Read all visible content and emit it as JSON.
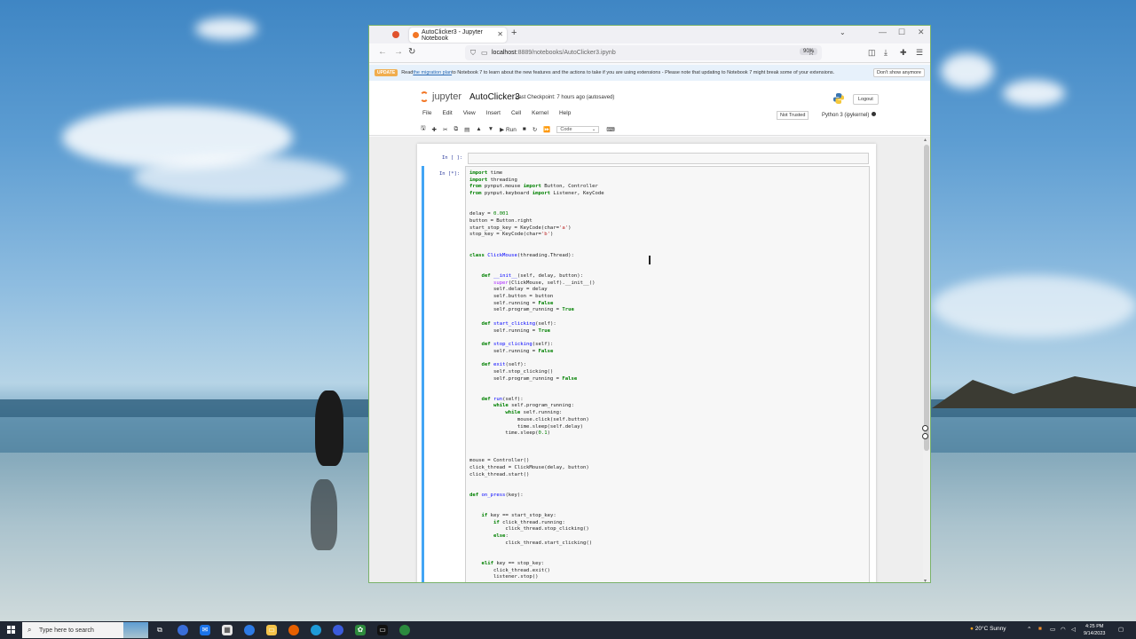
{
  "browser": {
    "tab_title": "AutoClicker3 - Jupyter Notebook",
    "new_tab": "+",
    "url_host": "localhost",
    "url_path": ":8889/notebooks/AutoClicker3.ipynb",
    "zoom": "90%"
  },
  "banner": {
    "badge": "UPDATE",
    "text_before": "Read ",
    "link": "the migration plan",
    "text_after": " to Notebook 7 to learn about the new features and the actions to take if you are using extensions - Please note that updating to Notebook 7 might break some of your extensions.",
    "dismiss": "Don't show anymore"
  },
  "header": {
    "logo_text": "jupyter",
    "notebook_name": "AutoClicker3",
    "checkpoint": "Last Checkpoint: 7 hours ago  (autosaved)",
    "logout": "Logout",
    "trust": "Not Trusted",
    "kernel": "Python 3 (ipykernel)"
  },
  "menu": [
    "File",
    "Edit",
    "View",
    "Insert",
    "Cell",
    "Kernel",
    "Help"
  ],
  "toolbar": {
    "run_label": "Run",
    "cell_type": "Code"
  },
  "cells": {
    "empty_prompt": "In [ ]:",
    "running_prompt": "In [*]:"
  },
  "taskbar": {
    "search_placeholder": "Type here to search",
    "weather": "20°C  Sunny",
    "time": "4:25 PM",
    "date": "9/14/2023"
  }
}
